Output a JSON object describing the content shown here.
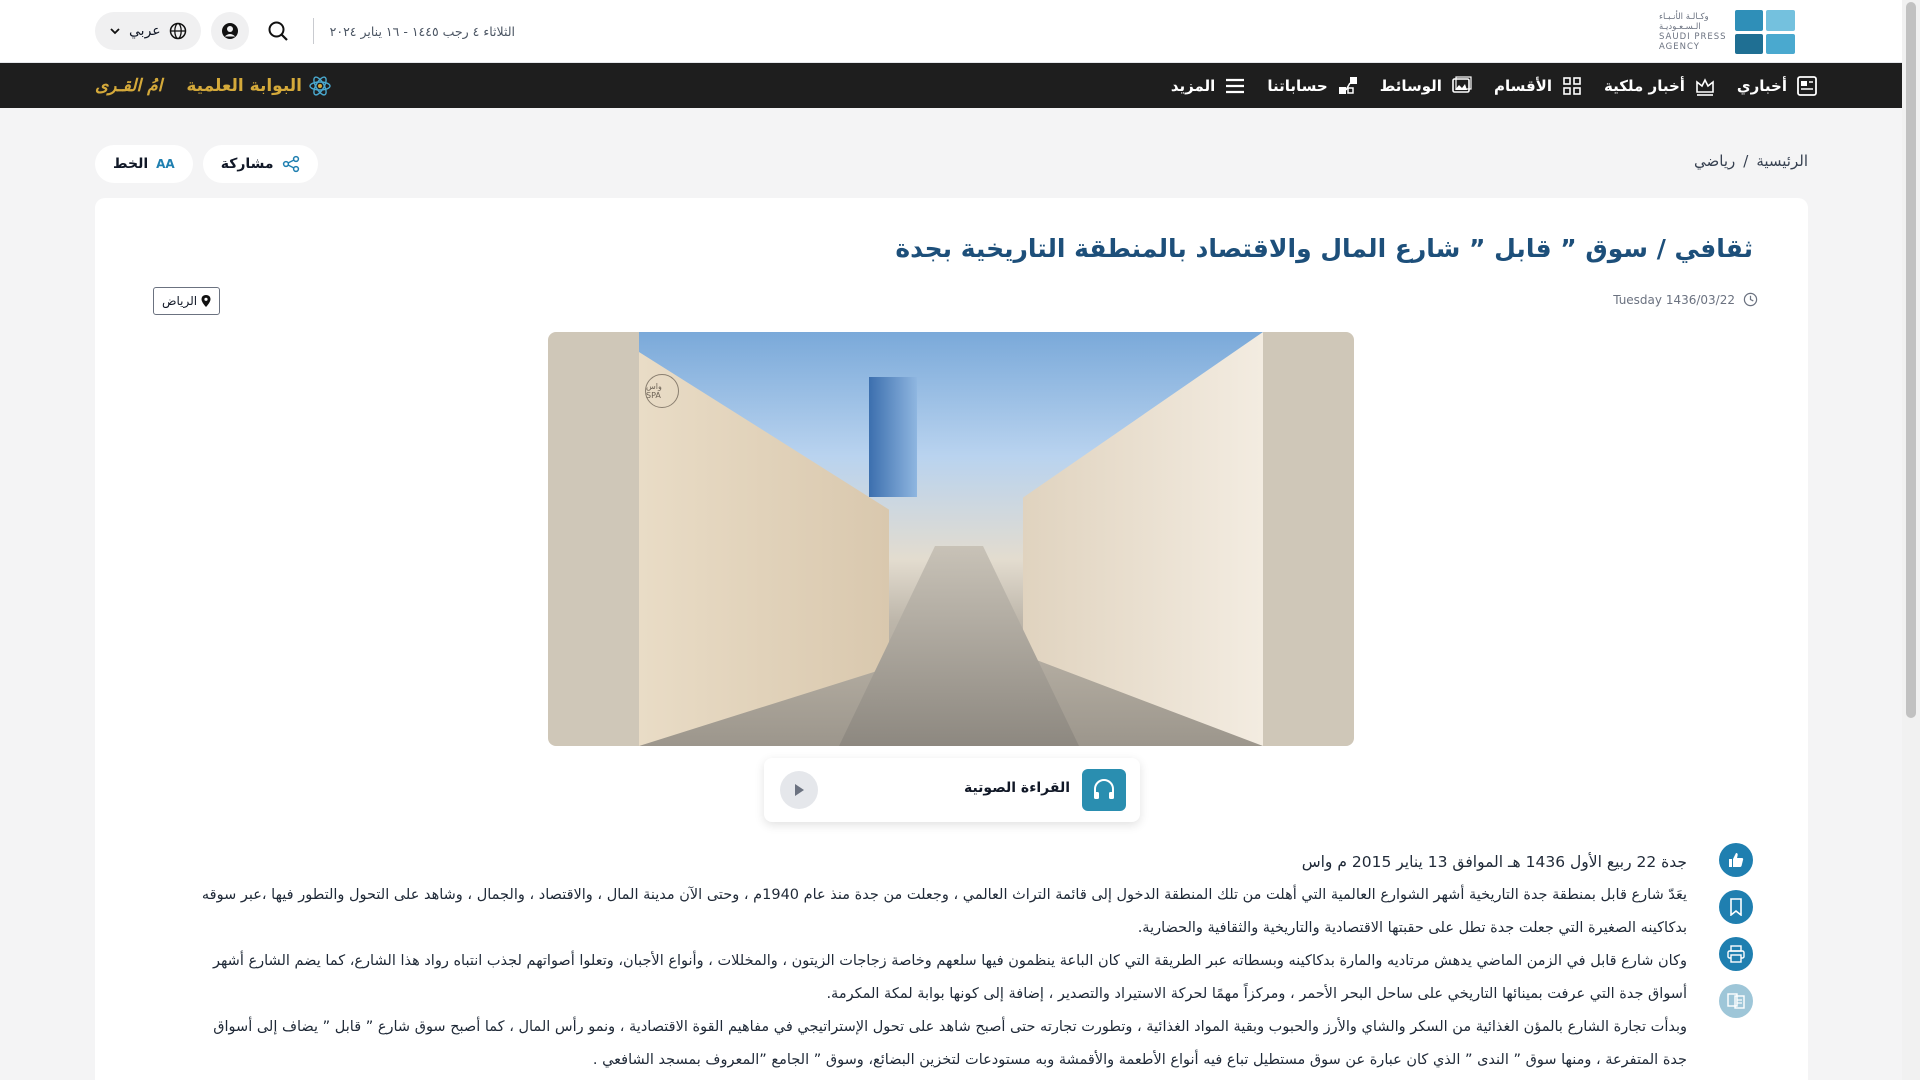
{
  "header": {
    "logo_lines": [
      "وكـالـة الأنـبـاء",
      "الـسـعـوديـة",
      "SAUDI PRESS",
      "AGENCY"
    ],
    "logo_mark": "SPA",
    "date_text": "الثلاثاء ٤ رجب ١٤٤٥ - ١٦ يناير ٢٠٢٤",
    "language_label": "عربي"
  },
  "nav": {
    "items": [
      {
        "label": "أخباري",
        "icon": "newspaper-icon"
      },
      {
        "label": "أخبار ملكية",
        "icon": "crown-news-icon"
      },
      {
        "label": "الأقسام",
        "icon": "grid-icon"
      },
      {
        "label": "الوسائط",
        "icon": "image-icon"
      },
      {
        "label": "حساباتنا",
        "icon": "network-icon"
      },
      {
        "label": "المزيد",
        "icon": "menu-icon"
      }
    ],
    "science_portal": "البوابة العلمية",
    "umm_alqura": "امُ القـرى"
  },
  "breadcrumb": {
    "home": "الرئيسية",
    "separator": "/",
    "section": "رياضي"
  },
  "utilities": {
    "share_label": "مشاركة",
    "font_label": "الخط",
    "font_icon_text": "AA"
  },
  "article": {
    "title": "ثقافي / سوق ” قابل ” شارع المال والاقتصاد بالمنطقة التاريخية بجدة",
    "date": "Tuesday 1436/03/22",
    "location": "الرياض",
    "image_stamp": "واس SPA",
    "audio_label": "القراءة الصوتية",
    "dateline": "جدة 22 ربيع الأول 1436 هـ الموافق 13 يناير 2015 م واس",
    "paragraphs": [
      "يعَدّ شارع قابل بمنطقة جدة التاريخية أشهر الشوارع العالمية التي أهلت من تلك المنطقة الدخول إلى قائمة التراث العالمي ، وجعلت من جدة منذ عام 1940م ، وحتى الآن مدينة المال ، والاقتصاد ، والجمال ، وشاهد على التحول والتطور فيها ،عبر سوقه بدكاكينه الصغيرة التي جعلت جدة تطل على حقبتها الاقتصادية والتاريخية والثقافية والحضارية.",
      "وكان شارع قابل في الزمن الماضي يدهش مرتاديه والمارة بدكاكينه وبسطاته عبر الطريقة التي كان الباعة ينظمون فيها سلعهم وخاصة زجاجات الزيتون ، والمخللات ، وأنواع الأجبان، وتعلوا أصواتهم لجذب انتباه رواد هذا الشارع، كما يضم الشارع أشهر أسواق جدة التي عرفت بمينائها التاريخي على ساحل البحر الأحمر ، ومركزاً مهمًا لحركة الاستيراد والتصدير ، إضافة إلى كونها بوابة لمكة المكرمة.",
      "وبدأت تجارة الشارع بالمؤن الغذائية من السكر والشاي والأرز والحبوب وبقية المواد الغذائية ، وتطورت تجارته حتى أصبح شاهد على تحول الإستراتيجي في مفاهيم القوة الاقتصادية ، ونمو رأس المال ، كما أصبح سوق شارع ” قابل ” يضاف إلى أسواق جدة المتفرعة ، ومنها سوق ” الندى ” الذي كان عبارة عن سوق مستطيل تباع فيه أنواع الأطعمة والأقمشة وبه مستودعات لتخزين البضائع، وسوق ” الجامع ”المعروف بمسجد الشافعي ."
    ]
  },
  "colors": {
    "nav_bg": "#1e1e1e",
    "title": "#1d4f7a",
    "accent": "#2a8eb0",
    "gold": "#d4a93a"
  }
}
